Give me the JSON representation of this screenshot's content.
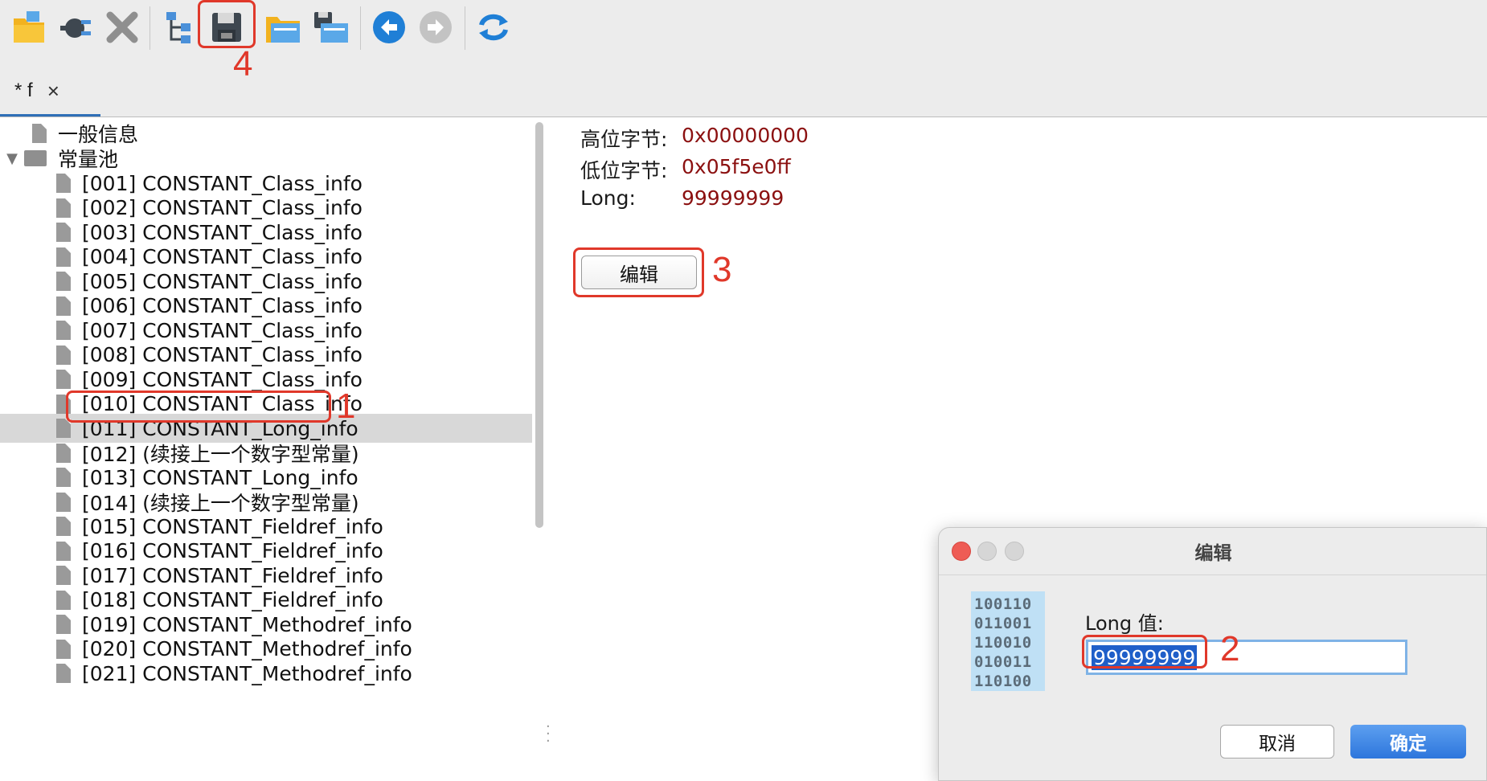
{
  "toolbar": {
    "buttons": [
      {
        "name": "open-file-icon"
      },
      {
        "name": "plugin-icon"
      },
      {
        "name": "close-icon"
      },
      {
        "name": "tree-structure-icon"
      },
      {
        "name": "save-icon"
      },
      {
        "name": "open-folder-icon"
      },
      {
        "name": "save-as-icon"
      },
      {
        "name": "back-arrow-icon"
      },
      {
        "name": "forward-arrow-icon"
      },
      {
        "name": "refresh-icon"
      }
    ]
  },
  "tab": {
    "label": "* f",
    "close_glyph": "×"
  },
  "tree": {
    "general_info": "一般信息",
    "constant_pool": "常量池",
    "items": [
      "[001] CONSTANT_Class_info",
      "[002] CONSTANT_Class_info",
      "[003] CONSTANT_Class_info",
      "[004] CONSTANT_Class_info",
      "[005] CONSTANT_Class_info",
      "[006] CONSTANT_Class_info",
      "[007] CONSTANT_Class_info",
      "[008] CONSTANT_Class_info",
      "[009] CONSTANT_Class_info",
      "[010] CONSTANT_Class_info",
      "[011] CONSTANT_Long_info",
      "[012] (续接上一个数字型常量)",
      "[013] CONSTANT_Long_info",
      "[014] (续接上一个数字型常量)",
      "[015] CONSTANT_Fieldref_info",
      "[016] CONSTANT_Fieldref_info",
      "[017] CONSTANT_Fieldref_info",
      "[018] CONSTANT_Fieldref_info",
      "[019] CONSTANT_Methodref_info",
      "[020] CONSTANT_Methodref_info",
      "[021] CONSTANT_Methodref_info"
    ],
    "selected_index": 10
  },
  "detail": {
    "high_bytes_label": "高位字节:",
    "high_bytes_value": "0x00000000",
    "low_bytes_label": "低位字节:",
    "low_bytes_value": "0x05f5e0ff",
    "long_label": "Long:",
    "long_value": "99999999",
    "edit_button": "编辑"
  },
  "dialog": {
    "title": "编辑",
    "binary_lines": [
      "100110",
      "011001",
      "110010",
      "010011",
      "110100"
    ],
    "field_label": "Long 值:",
    "field_value": "99999999",
    "cancel_button": "取消",
    "ok_button": "确定"
  },
  "annotations": {
    "one": "1",
    "two": "2",
    "three": "3",
    "four": "4"
  },
  "colors": {
    "annotation": "#e0382a",
    "value_text": "#8b1010",
    "accent": "#2d76dc",
    "selection": "#d8d8d8"
  }
}
